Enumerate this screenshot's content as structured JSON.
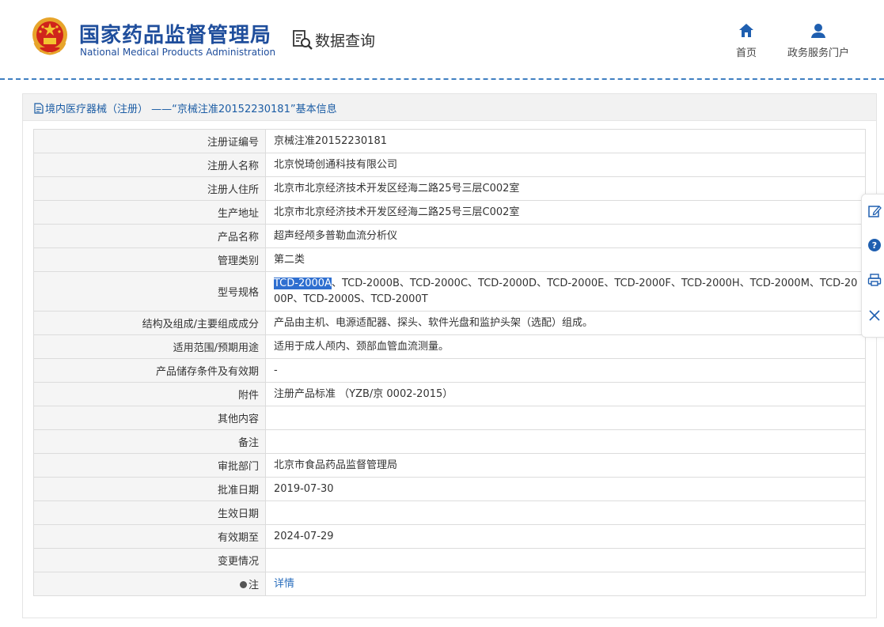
{
  "header": {
    "site_name_cn": "国家药品监督管理局",
    "site_name_en": "National Medical Products Administration",
    "section_title": "数据查询",
    "nav": [
      {
        "label": "首页",
        "icon": "home-icon"
      },
      {
        "label": "政务服务门户",
        "icon": "user-icon"
      }
    ]
  },
  "panel": {
    "title": "境内医疗器械（注册） ——“京械注准20152230181”基本信息"
  },
  "rows": [
    {
      "key": "注册证编号",
      "value": "京械注准20152230181"
    },
    {
      "key": "注册人名称",
      "value": "北京悦琦创通科技有限公司"
    },
    {
      "key": "注册人住所",
      "value": "北京市北京经济技术开发区经海二路25号三层C002室"
    },
    {
      "key": "生产地址",
      "value": "北京市北京经济技术开发区经海二路25号三层C002室"
    },
    {
      "key": "产品名称",
      "value": "超声经颅多普勒血流分析仪"
    },
    {
      "key": "管理类别",
      "value": "第二类"
    },
    {
      "key": "型号规格",
      "value_selected": "TCD-2000A",
      "value_rest": "、TCD-2000B、TCD-2000C、TCD-2000D、TCD-2000E、TCD-2000F、TCD-2000H、TCD-2000M、TCD-2000P、TCD-2000S、TCD-2000T"
    },
    {
      "key": "结构及组成/主要组成成分",
      "value": "产品由主机、电源适配器、探头、软件光盘和监护头架（选配）组成。"
    },
    {
      "key": "适用范围/预期用途",
      "value": "适用于成人颅内、颈部血管血流测量。"
    },
    {
      "key": "产品储存条件及有效期",
      "value": "-"
    },
    {
      "key": "附件",
      "value": "注册产品标准 （YZB/京 0002-2015）"
    },
    {
      "key": "其他内容",
      "value": ""
    },
    {
      "key": "备注",
      "value": ""
    },
    {
      "key": "审批部门",
      "value": "北京市食品药品监督管理局"
    },
    {
      "key": "批准日期",
      "value": "2019-07-30"
    },
    {
      "key": "生效日期",
      "value": ""
    },
    {
      "key": "有效期至",
      "value": "2024-07-29"
    },
    {
      "key": "变更情况",
      "value": ""
    },
    {
      "key": "注",
      "value": "详情"
    }
  ],
  "float_toolbar": [
    {
      "icon": "edit-icon"
    },
    {
      "icon": "help-icon"
    },
    {
      "icon": "print-icon"
    },
    {
      "icon": "close-icon"
    }
  ],
  "colors": {
    "brand": "#1f4e9c",
    "link": "#2a6ebd",
    "selection": "#2f6fd0"
  }
}
